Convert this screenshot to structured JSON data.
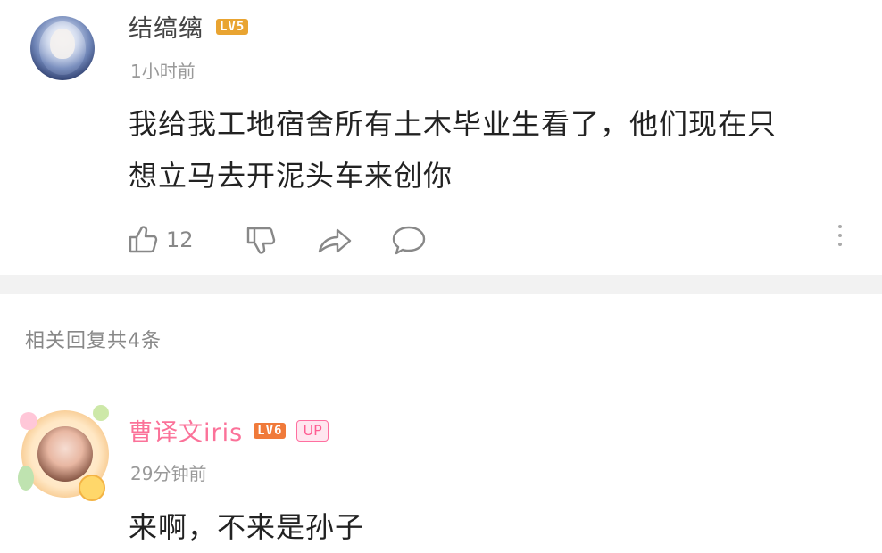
{
  "comment": {
    "username": "结缟缡",
    "level": "LV5",
    "time": "1小时前",
    "text_line1": "我给我工地宿舍所有土木毕业生看了，他们现在只",
    "text_line2": "想立马去开泥头车来创你",
    "like_count": "12",
    "icons": [
      "thumbs-up-icon",
      "thumbs-down-icon",
      "share-icon",
      "comment-icon",
      "more-icon"
    ]
  },
  "replies_header": "相关回复共4条",
  "reply": {
    "username": "曹译文iris",
    "level": "LV6",
    "up_badge": "UP",
    "time": "29分钟前",
    "text": "来啊，不来是孙子"
  },
  "colors": {
    "background": "#ffffff",
    "divider": "#f2f2f2",
    "username_gray": "#444444",
    "reply_username_pink": "#fb7299",
    "lv5_badge": "#e9a431",
    "lv6_badge": "#f07a3a",
    "meta_gray": "#999999"
  }
}
